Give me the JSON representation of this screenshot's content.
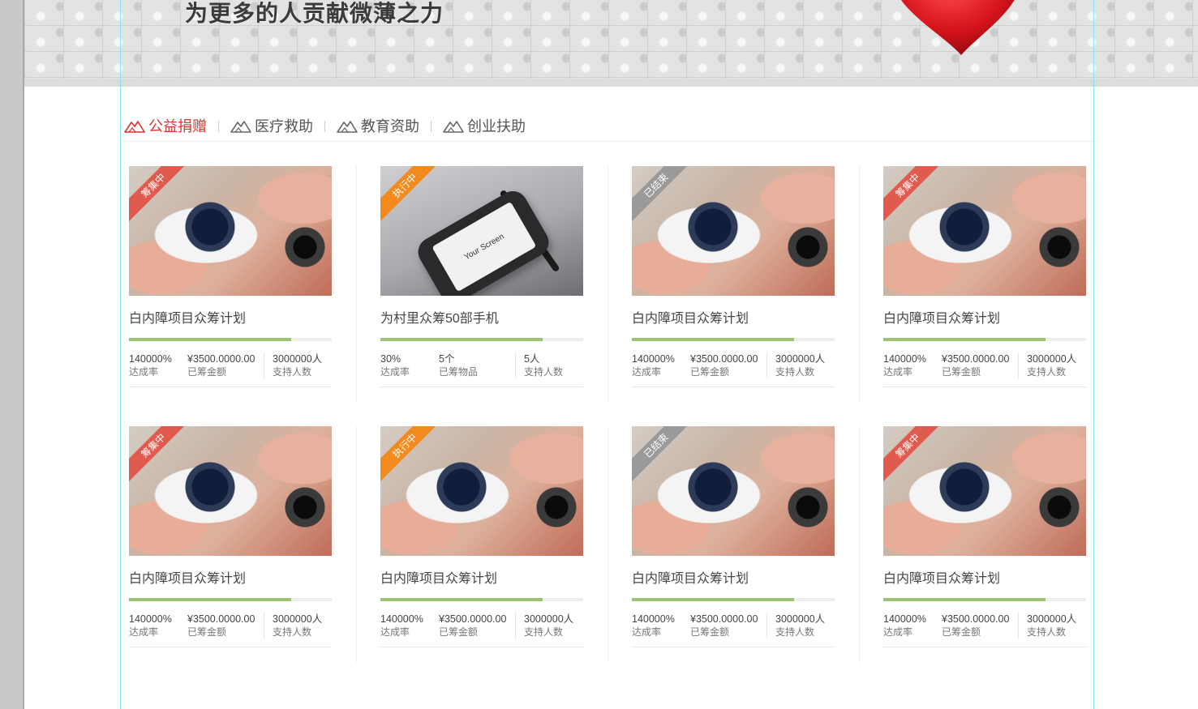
{
  "banner": {
    "slogan": "为更多的人贡献微薄之力"
  },
  "tabs": [
    {
      "label": "公益捐赠",
      "active": true
    },
    {
      "label": "医疗救助",
      "active": false
    },
    {
      "label": "教育资助",
      "active": false
    },
    {
      "label": "创业扶助",
      "active": false
    }
  ],
  "colors": {
    "accent": "#d9332d",
    "progress": "#9bc372",
    "badge_raising": "#e05a4e",
    "badge_executing": "#f28a1e",
    "badge_ended": "#9a9a9a"
  },
  "cards": [
    {
      "badge": "筹集中",
      "badge_type": "raising",
      "image": "camera-lens-photo",
      "title": "白内障项目众筹计划",
      "progress": 0.8,
      "stats": [
        {
          "value": "140000%",
          "label": "达成率"
        },
        {
          "value": "¥3500.0000.00",
          "label": "已筹金额"
        },
        {
          "value": "3000000人",
          "label": "支持人数"
        }
      ]
    },
    {
      "badge": "执行中",
      "badge_type": "executing",
      "image": "smartphone-photo",
      "image_text": "Your Screen",
      "title": "为村里众筹50部手机",
      "progress": 0.8,
      "stats": [
        {
          "value": "30%",
          "label": "达成率"
        },
        {
          "value": "5个",
          "label": "已筹物品"
        },
        {
          "value": "5人",
          "label": "支持人数"
        }
      ]
    },
    {
      "badge": "已结束",
      "badge_type": "ended",
      "image": "camera-lens-photo",
      "title": "白内障项目众筹计划",
      "progress": 0.8,
      "stats": [
        {
          "value": "140000%",
          "label": "达成率"
        },
        {
          "value": "¥3500.0000.00",
          "label": "已筹金额"
        },
        {
          "value": "3000000人",
          "label": "支持人数"
        }
      ]
    },
    {
      "badge": "筹集中",
      "badge_type": "raising",
      "image": "camera-lens-photo",
      "title": "白内障项目众筹计划",
      "progress": 0.8,
      "stats": [
        {
          "value": "140000%",
          "label": "达成率"
        },
        {
          "value": "¥3500.0000.00",
          "label": "已筹金额"
        },
        {
          "value": "3000000人",
          "label": "支持人数"
        }
      ]
    },
    {
      "badge": "筹集中",
      "badge_type": "raising",
      "image": "camera-lens-photo",
      "title": "白内障项目众筹计划",
      "progress": 0.8,
      "stats": [
        {
          "value": "140000%",
          "label": "达成率"
        },
        {
          "value": "¥3500.0000.00",
          "label": "已筹金额"
        },
        {
          "value": "3000000人",
          "label": "支持人数"
        }
      ]
    },
    {
      "badge": "执行中",
      "badge_type": "executing",
      "image": "camera-lens-photo",
      "title": "白内障项目众筹计划",
      "progress": 0.8,
      "stats": [
        {
          "value": "140000%",
          "label": "达成率"
        },
        {
          "value": "¥3500.0000.00",
          "label": "已筹金额"
        },
        {
          "value": "3000000人",
          "label": "支持人数"
        }
      ]
    },
    {
      "badge": "已结束",
      "badge_type": "ended",
      "image": "camera-lens-photo",
      "title": "白内障项目众筹计划",
      "progress": 0.8,
      "stats": [
        {
          "value": "140000%",
          "label": "达成率"
        },
        {
          "value": "¥3500.0000.00",
          "label": "已筹金额"
        },
        {
          "value": "3000000人",
          "label": "支持人数"
        }
      ]
    },
    {
      "badge": "筹集中",
      "badge_type": "raising",
      "image": "camera-lens-photo",
      "title": "白内障项目众筹计划",
      "progress": 0.8,
      "stats": [
        {
          "value": "140000%",
          "label": "达成率"
        },
        {
          "value": "¥3500.0000.00",
          "label": "已筹金额"
        },
        {
          "value": "3000000人",
          "label": "支持人数"
        }
      ]
    }
  ]
}
